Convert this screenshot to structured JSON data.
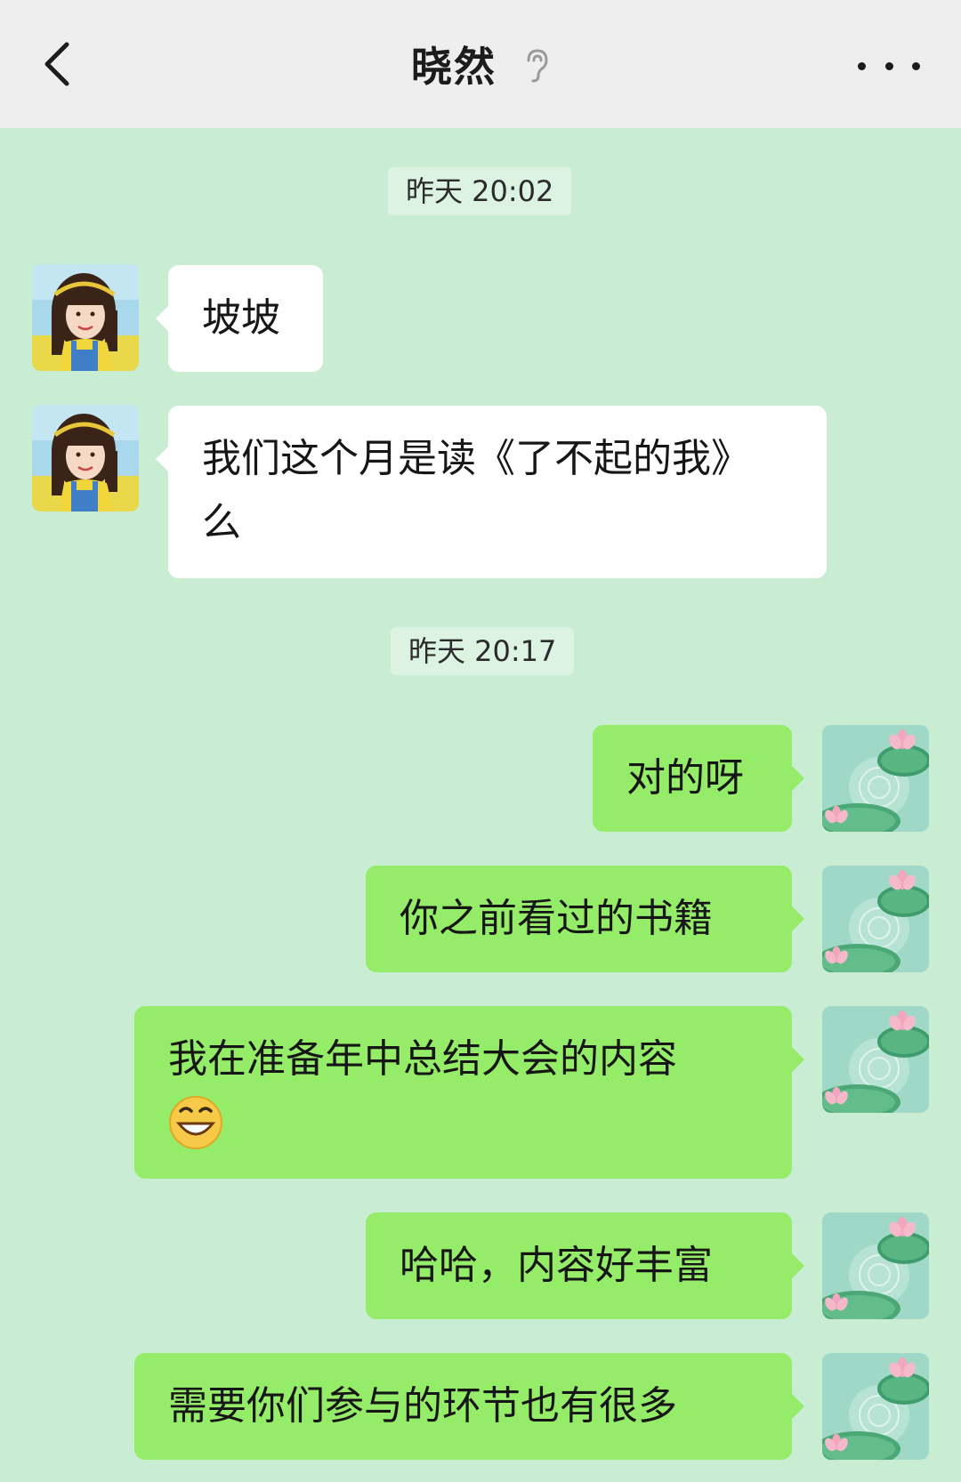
{
  "header": {
    "back_icon": "chevron-left-icon",
    "title": "晓然",
    "listen_icon": "ear-icon",
    "more_icon": "more-dots-icon"
  },
  "timestamps": [
    "昨天 20:02",
    "昨天 20:17"
  ],
  "messages": [
    {
      "sender": "contact",
      "text": "坡坡"
    },
    {
      "sender": "contact",
      "text": "我们这个月是读《了不起的我》\n么"
    },
    {
      "sender": "me",
      "text": "对的呀"
    },
    {
      "sender": "me",
      "text": "你之前看过的书籍"
    },
    {
      "sender": "me",
      "text": "我在准备年中总结大会的内容",
      "emoji": "grinning-face-icon"
    },
    {
      "sender": "me",
      "text": "哈哈，内容好丰富"
    },
    {
      "sender": "me",
      "text": "需要你们参与的环节也有很多"
    }
  ],
  "colors": {
    "chat_background": "#c9edd3",
    "header_background": "#eeeeee",
    "incoming_bubble": "#ffffff",
    "outgoing_bubble": "#95ec69",
    "timestamp_background": "#ddf3e2"
  }
}
